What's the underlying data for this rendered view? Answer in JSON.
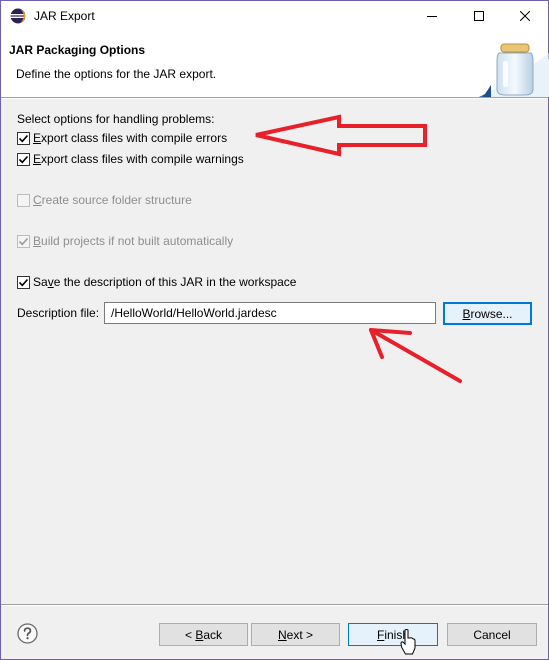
{
  "window": {
    "title": "JAR Export",
    "controls": [
      "minimize-icon",
      "maximize-icon",
      "close-icon"
    ]
  },
  "header": {
    "title": "JAR Packaging Options",
    "description": "Define the options for the JAR export."
  },
  "problems": {
    "heading": "Select options for handling problems:",
    "export_errors": {
      "mnemonic": "E",
      "rest": "xport class files with compile errors",
      "checked": true
    },
    "export_warnings": {
      "mnemonic": "E",
      "rest": "xport class files with compile warnings",
      "checked": true
    }
  },
  "create_source_folder": {
    "mnemonic": "C",
    "rest": "reate source folder structure",
    "checked": false,
    "enabled": false
  },
  "build_projects": {
    "mnemonic": "B",
    "rest": "uild projects if not built automatically",
    "checked": true,
    "enabled": false
  },
  "save_description": {
    "prefix": "Sa",
    "mnemonic": "v",
    "rest": "e the description of this JAR in the workspace",
    "checked": true
  },
  "description_file": {
    "label": "Description file:",
    "value": "/HelloWorld/HelloWorld.jardesc",
    "browse": {
      "mnemonic": "B",
      "rest": "rowse..."
    }
  },
  "footer": {
    "back": {
      "prefix": "< ",
      "mnemonic": "B",
      "rest": "ack"
    },
    "next": {
      "mnemonic": "N",
      "rest": "ext >"
    },
    "finish": {
      "mnemonic": "F",
      "rest": "inish"
    },
    "cancel": "Cancel"
  },
  "colors": {
    "annotation_arrow": "#e8202a",
    "focus_border": "#0078d7",
    "checkbox_check": "#000000"
  }
}
